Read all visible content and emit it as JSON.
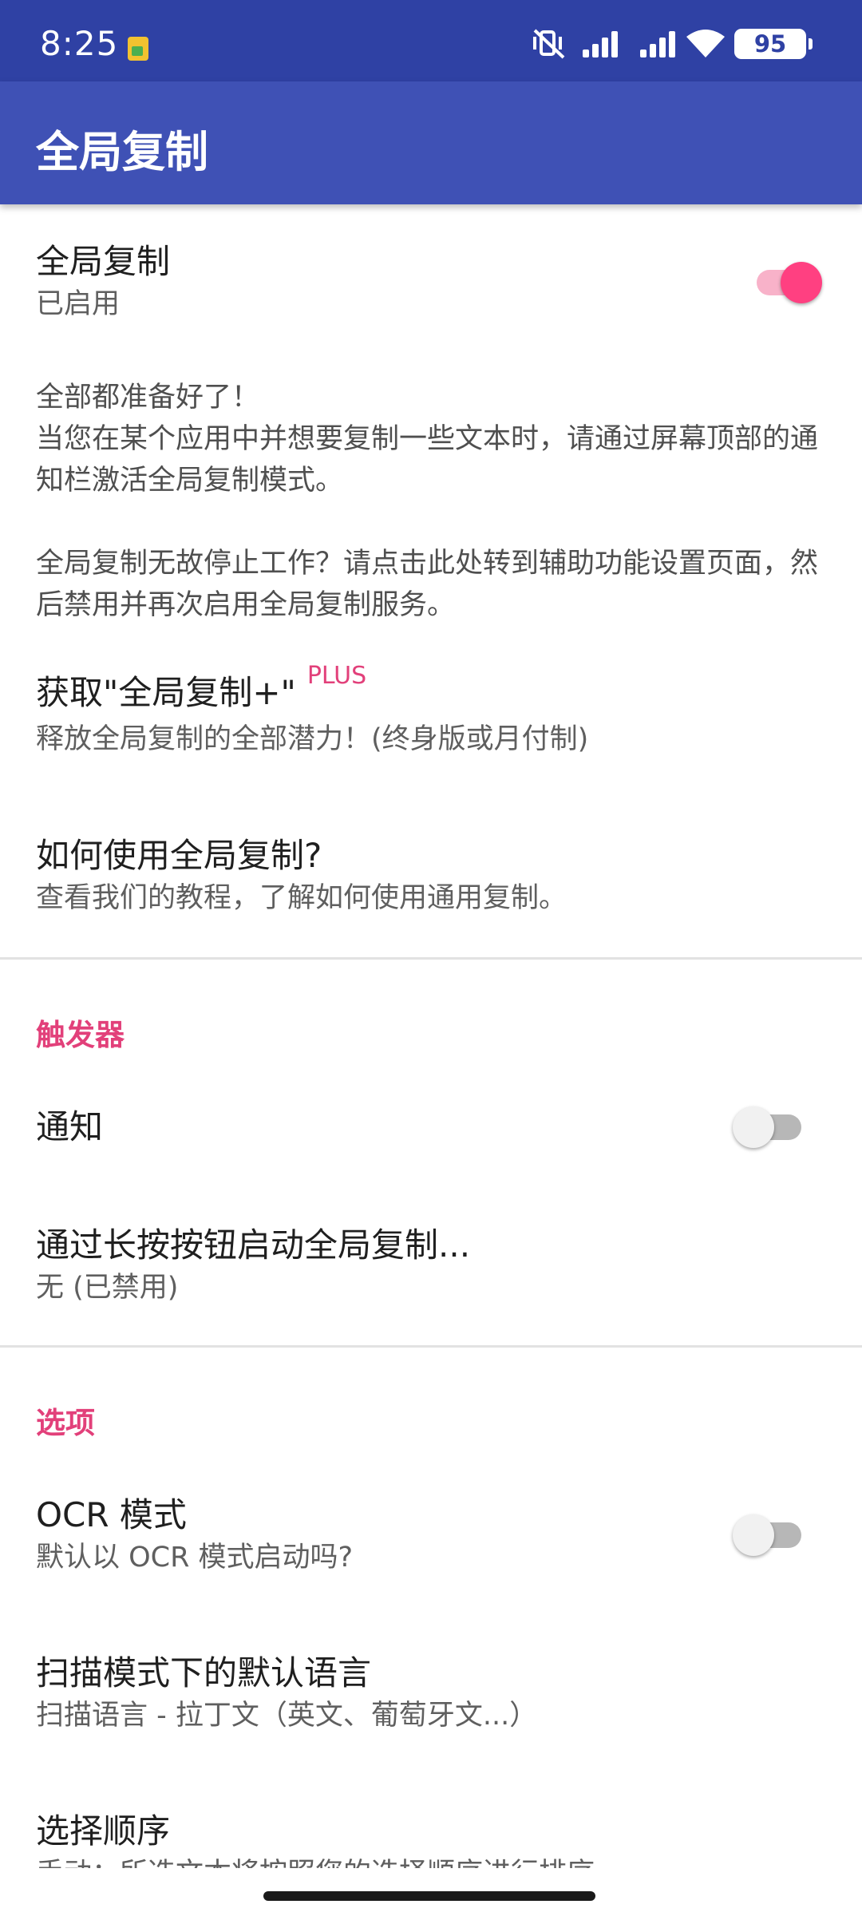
{
  "status": {
    "time": "8:25",
    "battery": "95"
  },
  "app": {
    "title": "全局复制"
  },
  "global_copy": {
    "title": "全局复制",
    "status": "已启用",
    "enabled": true
  },
  "intro": {
    "line1": "全部都准备好了！",
    "line2": "当您在某个应用中并想要复制一些文本时，请通过屏幕顶部的通知栏激活全局复制模式。",
    "line3": "全局复制无故停止工作？请点击此处转到辅助功能设置页面，然后禁用并再次启用全局复制服务。"
  },
  "plus": {
    "title": "获取\"全局复制+\"",
    "badge": "PLUS",
    "subtitle": "释放全局复制的全部潜力！(终身版或月付制)"
  },
  "howto": {
    "title": "如何使用全局复制?",
    "subtitle": "查看我们的教程，了解如何使用通用复制。"
  },
  "triggers": {
    "header": "触发器",
    "notification": {
      "title": "通知",
      "enabled": false
    },
    "long_press": {
      "title": "通过长按按钮启动全局复制...",
      "subtitle": "无 (已禁用)"
    }
  },
  "options": {
    "header": "选项",
    "ocr": {
      "title": "OCR 模式",
      "subtitle": "默认以 OCR 模式启动吗?",
      "enabled": false
    },
    "language": {
      "title": "扫描模式下的默认语言",
      "subtitle": "扫描语言 - 拉丁文（英文、葡萄牙文...）"
    },
    "order": {
      "title": "选择顺序",
      "subtitle": "手动：所选文本将按照您的选择顺序进行排序"
    }
  },
  "icons": {
    "sim": "sim-card-icon",
    "mute": "vibrate-off-icon",
    "signal": "signal-icon",
    "wifi": "wifi-icon",
    "battery": "battery-icon"
  },
  "colors": {
    "status_bar": "#2f41a4",
    "app_bar": "#3f51b5",
    "accent": "#e2407a",
    "switch_on": "#ff4081"
  }
}
